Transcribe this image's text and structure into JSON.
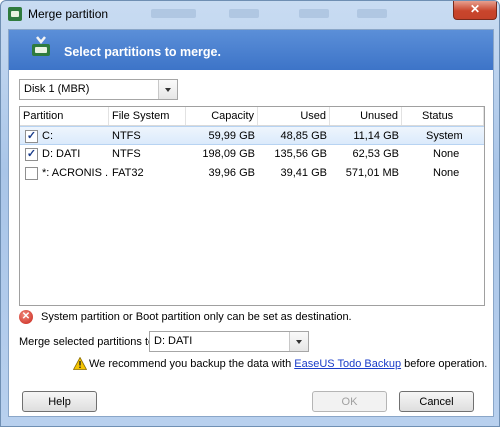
{
  "window": {
    "title": "Merge partition",
    "close_glyph": "✕"
  },
  "header": {
    "text": "Select partitions to merge."
  },
  "disk_select": {
    "value": "Disk 1 (MBR)"
  },
  "table": {
    "columns": [
      "Partition",
      "File System",
      "Capacity",
      "Used",
      "Unused",
      "Status"
    ],
    "rows": [
      {
        "checked": true,
        "partition": "C:",
        "fs": "NTFS",
        "capacity": "59,99 GB",
        "used": "48,85 GB",
        "unused": "11,14 GB",
        "status": "System"
      },
      {
        "checked": true,
        "partition": "D: DATI",
        "fs": "NTFS",
        "capacity": "198,09 GB",
        "used": "135,56 GB",
        "unused": "62,53 GB",
        "status": "None"
      },
      {
        "checked": false,
        "partition": "*: ACRONIS ...",
        "fs": "FAT32",
        "capacity": "39,96 GB",
        "used": "39,41 GB",
        "unused": "571,01 MB",
        "status": "None"
      }
    ]
  },
  "error_message": "System partition or Boot partition only can be set as destination.",
  "merge_target": {
    "label": "Merge selected partitions to:",
    "value": "D: DATI"
  },
  "note": {
    "before": "We recommend you backup the data with ",
    "link": "EaseUS Todo Backup",
    "after": " before operation."
  },
  "buttons": {
    "help": "Help",
    "ok": "OK",
    "cancel": "Cancel"
  },
  "colors": {
    "header_bg": "#3d74c8",
    "close_btn": "#c9452c",
    "link": "#1a3cc8"
  },
  "icons": {
    "window": "partition-app-icon",
    "header": "merge-partition-icon",
    "error": "error-x-icon",
    "warning": "warning-triangle-icon"
  }
}
